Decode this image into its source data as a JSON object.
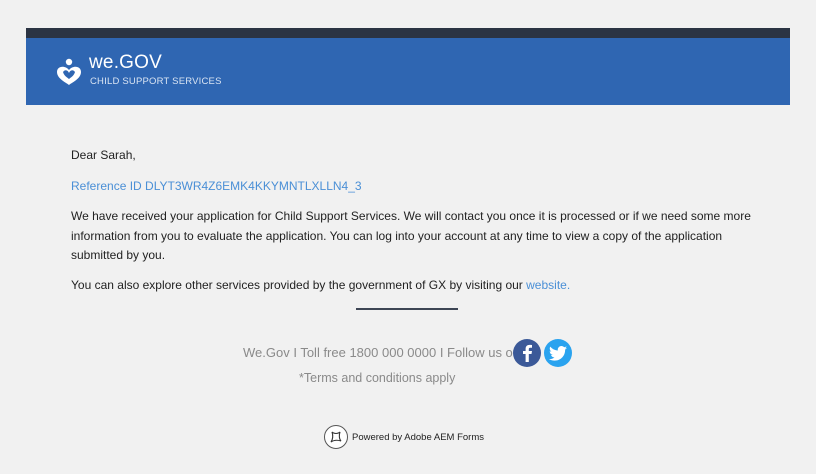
{
  "header": {
    "brand": "we.GOV",
    "tagline": "CHILD SUPPORT SERVICES"
  },
  "email": {
    "greeting": "Dear Sarah,",
    "reference": "Reference ID DLYT3WR4Z6EMK4KKYMNTLXLLN4_3",
    "body": "We have received your application for Child Support Services. We will contact you once it is processed or if we need some more information from you to evaluate the application. You can log into your account at any time to view a copy of the application submitted by you.",
    "explore_text": "You can also explore other services provided by the government of GX by visiting our ",
    "explore_link": "website."
  },
  "footer": {
    "contact": "We.Gov I Toll free 1800 000 0000 I Follow us on",
    "terms": "*Terms and conditions apply",
    "powered": "Powered by Adobe AEM Forms"
  },
  "icons": {
    "logo": "wegov-logo-icon",
    "facebook": "facebook-icon",
    "twitter": "twitter-icon",
    "aem": "adobe-aem-icon"
  },
  "colors": {
    "header": "#2f66b2",
    "header_bar": "#2b3443",
    "link": "#4a8fd6",
    "facebook": "#3b5998",
    "twitter": "#2aa3ef"
  }
}
